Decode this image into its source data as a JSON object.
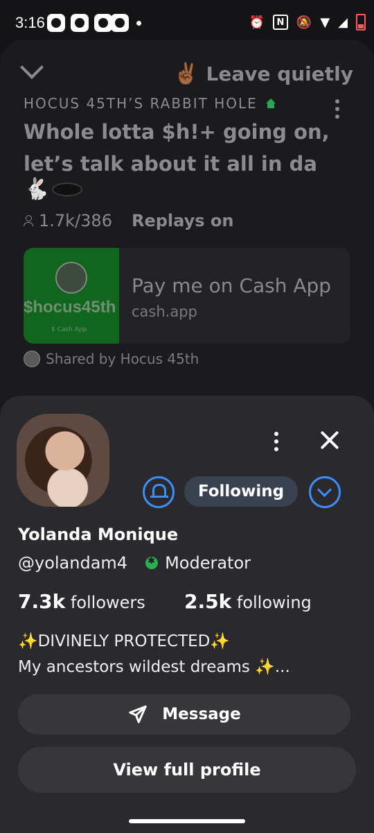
{
  "status_bar": {
    "time": "3:16",
    "icons": [
      "alarm-icon",
      "nfc-icon",
      "bell-off-icon",
      "wifi-icon",
      "signal-icon",
      "battery-low-icon"
    ]
  },
  "room": {
    "leave_label": "Leave quietly",
    "leave_emoji": "✌🏾",
    "club_name": "HOCUS 45TH’S RABBIT HOLE",
    "title": "Whole lotta $h!+ going on, let’s talk about it all in da",
    "title_emoji": "🐇",
    "listeners": "1.7k/386",
    "replays": "Replays on",
    "link": {
      "thumb_handle": "$hocus45th",
      "thumb_caption": "$ Cash App",
      "title": "Pay me on Cash App",
      "domain": "cash.app"
    },
    "shared_by": "Shared by Hocus 45th"
  },
  "profile": {
    "following_label": "Following",
    "name": "Yolanda Monique",
    "handle": "@yolandam4",
    "role": "Moderator",
    "followers_count": "7.3k",
    "followers_label": "followers",
    "following_count": "2.5k",
    "following_label_stat": "following",
    "bio_line1": "DIVINELY PROTECTED",
    "bio_line2": "My ancestors wildest dreams",
    "spark": "✨",
    "ellipsis": "...",
    "message_label": "Message",
    "view_profile_label": "View full profile"
  },
  "colors": {
    "accent_blue": "#3e8ef7",
    "moderator_green": "#2bb04f",
    "cash_green": "#10661f"
  }
}
